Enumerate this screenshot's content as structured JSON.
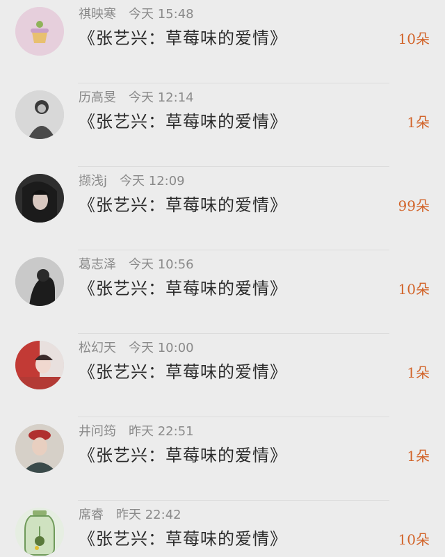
{
  "rows": [
    {
      "name": "祺映寒",
      "time": "今天 15:48",
      "title": "《张艺兴：草莓味的爱情》",
      "amount": "10朵",
      "avatar_icon": "cake-avatar-icon"
    },
    {
      "name": "历高旻",
      "time": "今天 12:14",
      "title": "《张艺兴：草莓味的爱情》",
      "amount": "1朵",
      "avatar_icon": "person-avatar-icon"
    },
    {
      "name": "撷浅j",
      "time": "今天 12:09",
      "title": "《张艺兴：草莓味的爱情》",
      "amount": "99朵",
      "avatar_icon": "person-avatar-icon"
    },
    {
      "name": "葛志泽",
      "time": "今天 10:56",
      "title": "《张艺兴：草莓味的爱情》",
      "amount": "10朵",
      "avatar_icon": "person-avatar-icon"
    },
    {
      "name": "松幻天",
      "time": "今天 10:00",
      "title": "《张艺兴：草莓味的爱情》",
      "amount": "1朵",
      "avatar_icon": "person-avatar-icon"
    },
    {
      "name": "井问筠",
      "time": "昨天 22:51",
      "title": "《张艺兴：草莓味的爱情》",
      "amount": "1朵",
      "avatar_icon": "person-avatar-icon"
    },
    {
      "name": "席睿",
      "time": "昨天 22:42",
      "title": "《张艺兴：草莓味的爱情》",
      "amount": "10朵",
      "avatar_icon": "jar-avatar-icon"
    }
  ],
  "colors": {
    "background": "#ececec",
    "meta_text": "#8a8a8a",
    "title_text": "#2b2b2b",
    "amount_text": "#d2642a"
  }
}
